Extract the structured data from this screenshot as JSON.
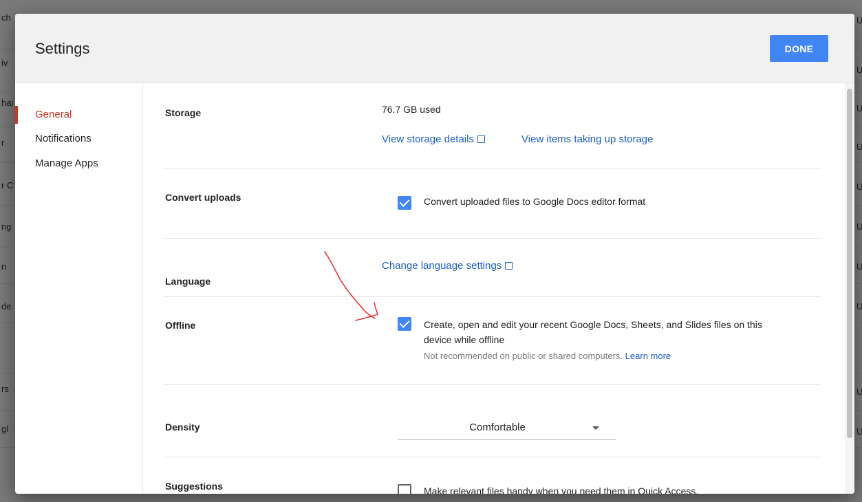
{
  "background": {
    "fragments_left": [
      "ch",
      "iv",
      "hai",
      "r",
      "r C",
      "ng",
      "n",
      "de",
      "rs",
      "gl"
    ],
    "fragments_right": [
      "U",
      "U",
      "U",
      "U",
      "U",
      "U",
      "U",
      "U",
      "U",
      "U"
    ]
  },
  "dialog": {
    "title": "Settings",
    "done_label": "DONE"
  },
  "sidebar": {
    "items": [
      {
        "label": "General",
        "active": true
      },
      {
        "label": "Notifications",
        "active": false
      },
      {
        "label": "Manage Apps",
        "active": false
      }
    ]
  },
  "settings": {
    "storage": {
      "label": "Storage",
      "used": "76.7 GB used",
      "details_link": "View storage details",
      "items_link": "View items taking up storage"
    },
    "convert": {
      "label": "Convert uploads",
      "checkbox_label": "Convert uploaded files to Google Docs editor format",
      "checked": true
    },
    "language": {
      "label": "Language",
      "link": "Change language settings"
    },
    "offline": {
      "label": "Offline",
      "checkbox_label_line1": "Create, open and edit your recent Google Docs, Sheets, and Slides files on this",
      "checkbox_label_line2": "device while offline",
      "note": "Not recommended on public or shared computers.",
      "learn_more": "Learn more",
      "checked": true
    },
    "density": {
      "label": "Density",
      "selected": "Comfortable"
    },
    "suggestions": {
      "label": "Suggestions",
      "checkbox_label": "Make relevant files handy when you need them in Quick Access.",
      "checked": false
    }
  },
  "colors": {
    "accent": "#4285f4",
    "link": "#1a5dc8",
    "active": "#c53929",
    "annotation": "#e53935"
  }
}
